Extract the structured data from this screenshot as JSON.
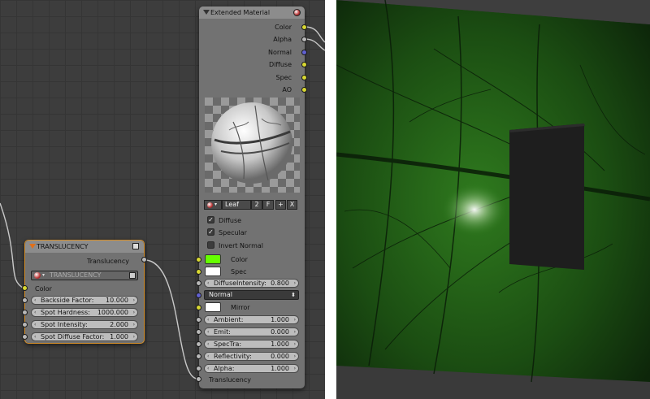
{
  "nodes": {
    "translucency": {
      "title": "TRANSLUCENCY",
      "output_label": "Translucency",
      "texture_select": "TRANSLUCENCY",
      "color_label": "Color",
      "fields": [
        {
          "label": "Backside Factor:",
          "value": "10.000"
        },
        {
          "label": "Spot Hardness:",
          "value": "1000.000"
        },
        {
          "label": "Spot Intensity:",
          "value": "2.000"
        },
        {
          "label": "Spot Diffuse Factor:",
          "value": "1.000"
        }
      ]
    },
    "extended_material": {
      "title": "Extended Material",
      "outputs": [
        "Color",
        "Alpha",
        "Normal",
        "Diffuse",
        "Spec",
        "AO"
      ],
      "material": {
        "name": "Leaf",
        "users": "2",
        "fake": "F",
        "add": "+",
        "remove": "X"
      },
      "checkboxes": [
        {
          "label": "Diffuse",
          "checked": "✓"
        },
        {
          "label": "Specular",
          "checked": "✓"
        },
        {
          "label": "Invert Normal",
          "checked": ""
        }
      ],
      "color_label": "Color",
      "spec_label": "Spec",
      "diffuse_intensity": {
        "label": "DiffuseIntensity:",
        "value": "0.800"
      },
      "normal_select": "Normal",
      "mirror_label": "Mirror",
      "fields": [
        {
          "label": "Ambient:",
          "value": "1.000"
        },
        {
          "label": "Emit:",
          "value": "0.000"
        },
        {
          "label": "SpecTra:",
          "value": "1.000"
        },
        {
          "label": "Reflectivity:",
          "value": "0.000"
        },
        {
          "label": "Alpha:",
          "value": "1.000"
        }
      ],
      "translucency_label": "Translucency"
    }
  },
  "colors": {
    "color_swatch": "#66ff00",
    "spec_swatch": "#ffffff",
    "mirror_swatch": "#ffffff",
    "socket_color": "#d8d832",
    "socket_value": "#b8b8b8",
    "socket_vector": "#6060d0"
  },
  "icons": {
    "collapse": "triangle-down-icon",
    "material_ball": "material-ball-icon",
    "node_link": "node-link-icon",
    "arrow_left": "‹",
    "arrow_right": "›",
    "dropdown": "⬍"
  }
}
